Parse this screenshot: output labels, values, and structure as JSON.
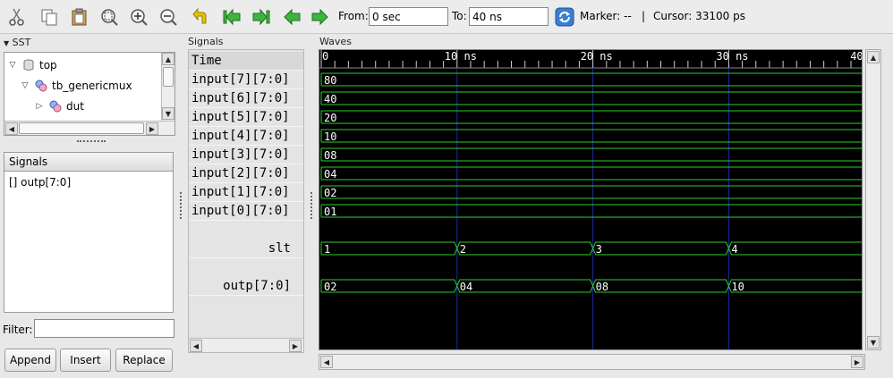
{
  "toolbar": {
    "from_label": "From:",
    "from_value": "0 sec",
    "to_label": "To:",
    "to_value": "40 ns",
    "marker_text": "Marker: --",
    "divider": "|",
    "cursor_text": "Cursor: 33100 ps"
  },
  "sst": {
    "title": "SST",
    "tree": [
      "top",
      "tb_genericmux",
      "dut"
    ]
  },
  "signals_panel": {
    "header": "Signals",
    "items": [
      "[] outp[7:0]"
    ]
  },
  "filter": {
    "label": "Filter:",
    "value": ""
  },
  "buttons": {
    "append": "Append",
    "insert": "Insert",
    "replace": "Replace"
  },
  "signals_pane_title": "Signals",
  "names": {
    "time": "Time",
    "rows": [
      "input[7][7:0]",
      "input[6][7:0]",
      "input[5][7:0]",
      "input[4][7:0]",
      "input[3][7:0]",
      "input[2][7:0]",
      "input[1][7:0]",
      "input[0][7:0]"
    ],
    "slt": "slt",
    "outp": "outp[7:0]"
  },
  "waves_title": "Waves",
  "timeline": {
    "labels": [
      "0",
      "10 ns",
      "20 ns",
      "30 ns",
      "40"
    ]
  },
  "waveforms": {
    "inputs": [
      "80",
      "40",
      "20",
      "10",
      "08",
      "04",
      "02",
      "01"
    ],
    "slt": [
      "1",
      "2",
      "3",
      "4"
    ],
    "outp": [
      "02",
      "04",
      "08",
      "10"
    ]
  },
  "colors": {
    "wave": "#2ecc2e",
    "background": "#000000",
    "grid": "#1b2a9c",
    "accent_icon": "#e8c200",
    "arrow": "#3fb43f"
  }
}
